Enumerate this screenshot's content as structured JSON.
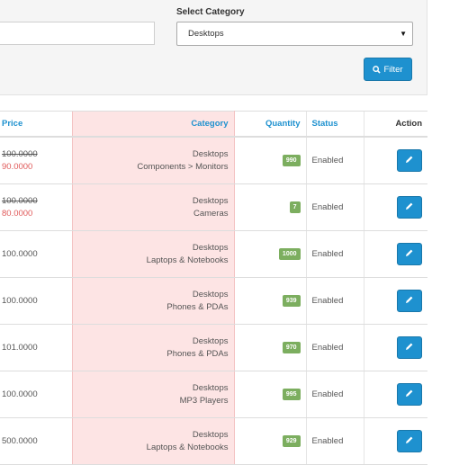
{
  "filter": {
    "select_category_label": "Select Category",
    "selected_category": "Desktops",
    "filter_button_label": "Filter"
  },
  "table": {
    "headers": {
      "price": "Price",
      "category": "Category",
      "quantity": "Quantity",
      "status": "Status",
      "action": "Action"
    },
    "rows": [
      {
        "old_price": "100.0000",
        "special_price": "90.0000",
        "category_1": "Desktops",
        "category_2": "Components  >  Monitors",
        "quantity": "990",
        "status": "Enabled"
      },
      {
        "old_price": "100.0000",
        "special_price": "80.0000",
        "category_1": "Desktops",
        "category_2": "Cameras",
        "quantity": "7",
        "status": "Enabled"
      },
      {
        "price": "100.0000",
        "category_1": "Desktops",
        "category_2": "Laptops & Notebooks",
        "quantity": "1000",
        "status": "Enabled"
      },
      {
        "price": "100.0000",
        "category_1": "Desktops",
        "category_2": "Phones & PDAs",
        "quantity": "939",
        "status": "Enabled"
      },
      {
        "price": "101.0000",
        "category_1": "Desktops",
        "category_2": "Phones & PDAs",
        "quantity": "970",
        "status": "Enabled"
      },
      {
        "price": "100.0000",
        "category_1": "Desktops",
        "category_2": "MP3 Players",
        "quantity": "995",
        "status": "Enabled"
      },
      {
        "price": "500.0000",
        "category_1": "Desktops",
        "category_2": "Laptops & Notebooks",
        "quantity": "929",
        "status": "Enabled"
      }
    ]
  },
  "colors": {
    "accent": "#1e91cf",
    "badge_green": "#7cae5f",
    "special_price_red": "#e05a5a",
    "category_highlight": "#fde4e4"
  }
}
